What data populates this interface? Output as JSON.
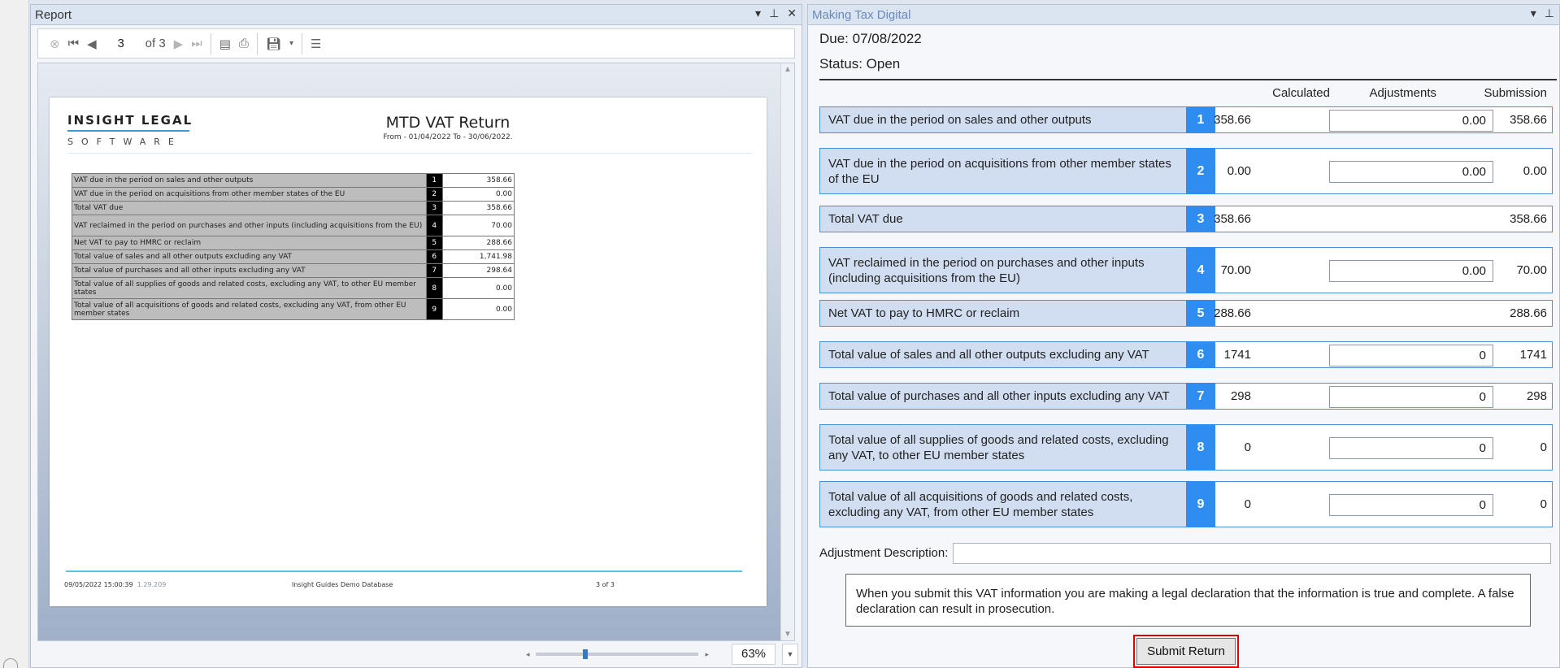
{
  "report_panel": {
    "title": "Report",
    "controls": [
      "▾",
      "ᵖ",
      "✕"
    ],
    "toolbar": {
      "current_page": "3",
      "page_total": "of 3"
    },
    "document": {
      "logo_top": "INSIGHT LEGAL",
      "logo_bottom": "SOFTWARE",
      "title": "MTD VAT Return",
      "subtitle": "From - 01/04/2022 To - 30/06/2022.",
      "rows": [
        {
          "label": "VAT due in the period on sales and other outputs",
          "num": "1",
          "value": "358.66"
        },
        {
          "label": "VAT due in the period on acquisitions from other member states of the EU",
          "num": "2",
          "value": "0.00"
        },
        {
          "label": "Total VAT due",
          "num": "3",
          "value": "358.66"
        },
        {
          "label": "VAT reclaimed in the period on purchases and other inputs (including acquisitions from the EU)",
          "num": "4",
          "value": "70.00"
        },
        {
          "label": "Net VAT to pay to HMRC or reclaim",
          "num": "5",
          "value": "288.66"
        },
        {
          "label": "Total value of sales and all other outputs excluding any VAT",
          "num": "6",
          "value": "1,741.98"
        },
        {
          "label": "Total value of purchases and all other inputs excluding any VAT",
          "num": "7",
          "value": "298.64"
        },
        {
          "label": "Total value of all supplies of goods and related costs, excluding any VAT, to other EU member states",
          "num": "8",
          "value": "0.00"
        },
        {
          "label": "Total value of all acquisitions of goods and related costs, excluding any VAT, from other EU member states",
          "num": "9",
          "value": "0.00"
        }
      ],
      "footer_date": "09/05/2022 15:00:39",
      "footer_version": "1.29.209",
      "footer_db": "Insight Guides Demo Database",
      "footer_page": "3 of 3"
    },
    "zoom": {
      "value": "63%",
      "level_percent": 63
    }
  },
  "mtd_panel": {
    "title": "Making Tax Digital",
    "due_label": "Due:",
    "due_value": "07/08/2022",
    "status_label": "Status:",
    "status_value": "Open",
    "col_calculated": "Calculated",
    "col_adjustments": "Adjustments",
    "col_submission": "Submission",
    "rows": [
      {
        "label": "VAT due in the period on sales and other outputs",
        "num": "1",
        "calculated": "358.66",
        "adjustment": "0.00",
        "submission": "358.66"
      },
      {
        "label": "VAT due in the period on acquisitions from other member states of the EU",
        "num": "2",
        "calculated": "0.00",
        "adjustment": "0.00",
        "submission": "0.00"
      },
      {
        "label": "Total VAT due",
        "num": "3",
        "calculated": "358.66",
        "adjustment": null,
        "submission": "358.66"
      },
      {
        "label": "VAT reclaimed in the period on purchases and other inputs (including acquisitions from the EU)",
        "num": "4",
        "calculated": "70.00",
        "adjustment": "0.00",
        "submission": "70.00"
      },
      {
        "label": "Net VAT to pay to HMRC or reclaim",
        "num": "5",
        "calculated": "288.66",
        "adjustment": null,
        "submission": "288.66"
      },
      {
        "label": "Total value of sales and all other outputs excluding any VAT",
        "num": "6",
        "calculated": "1741",
        "adjustment": "0",
        "submission": "1741"
      },
      {
        "label": "Total value of purchases and all other inputs excluding any VAT",
        "num": "7",
        "calculated": "298",
        "adjustment": "0",
        "submission": "298"
      },
      {
        "label": "Total value of all supplies of goods and related costs, excluding any VAT, to other EU member states",
        "num": "8",
        "calculated": "0",
        "adjustment": "0",
        "submission": "0"
      },
      {
        "label": "Total value of all acquisitions of goods and related costs, excluding any VAT, from other EU member states",
        "num": "9",
        "calculated": "0",
        "adjustment": "0",
        "submission": "0"
      }
    ],
    "adjustment_description_label": "Adjustment Description:",
    "adjustment_description_value": "",
    "declaration": "When you submit this VAT information you are making a legal declaration that the information is true and complete. A false declaration can result in prosecution.",
    "submit_label": "Submit Return"
  },
  "colors": {
    "accent_blue": "#2f8df2",
    "row_bg": "#d1def1",
    "highlight_red": "#e00000"
  }
}
